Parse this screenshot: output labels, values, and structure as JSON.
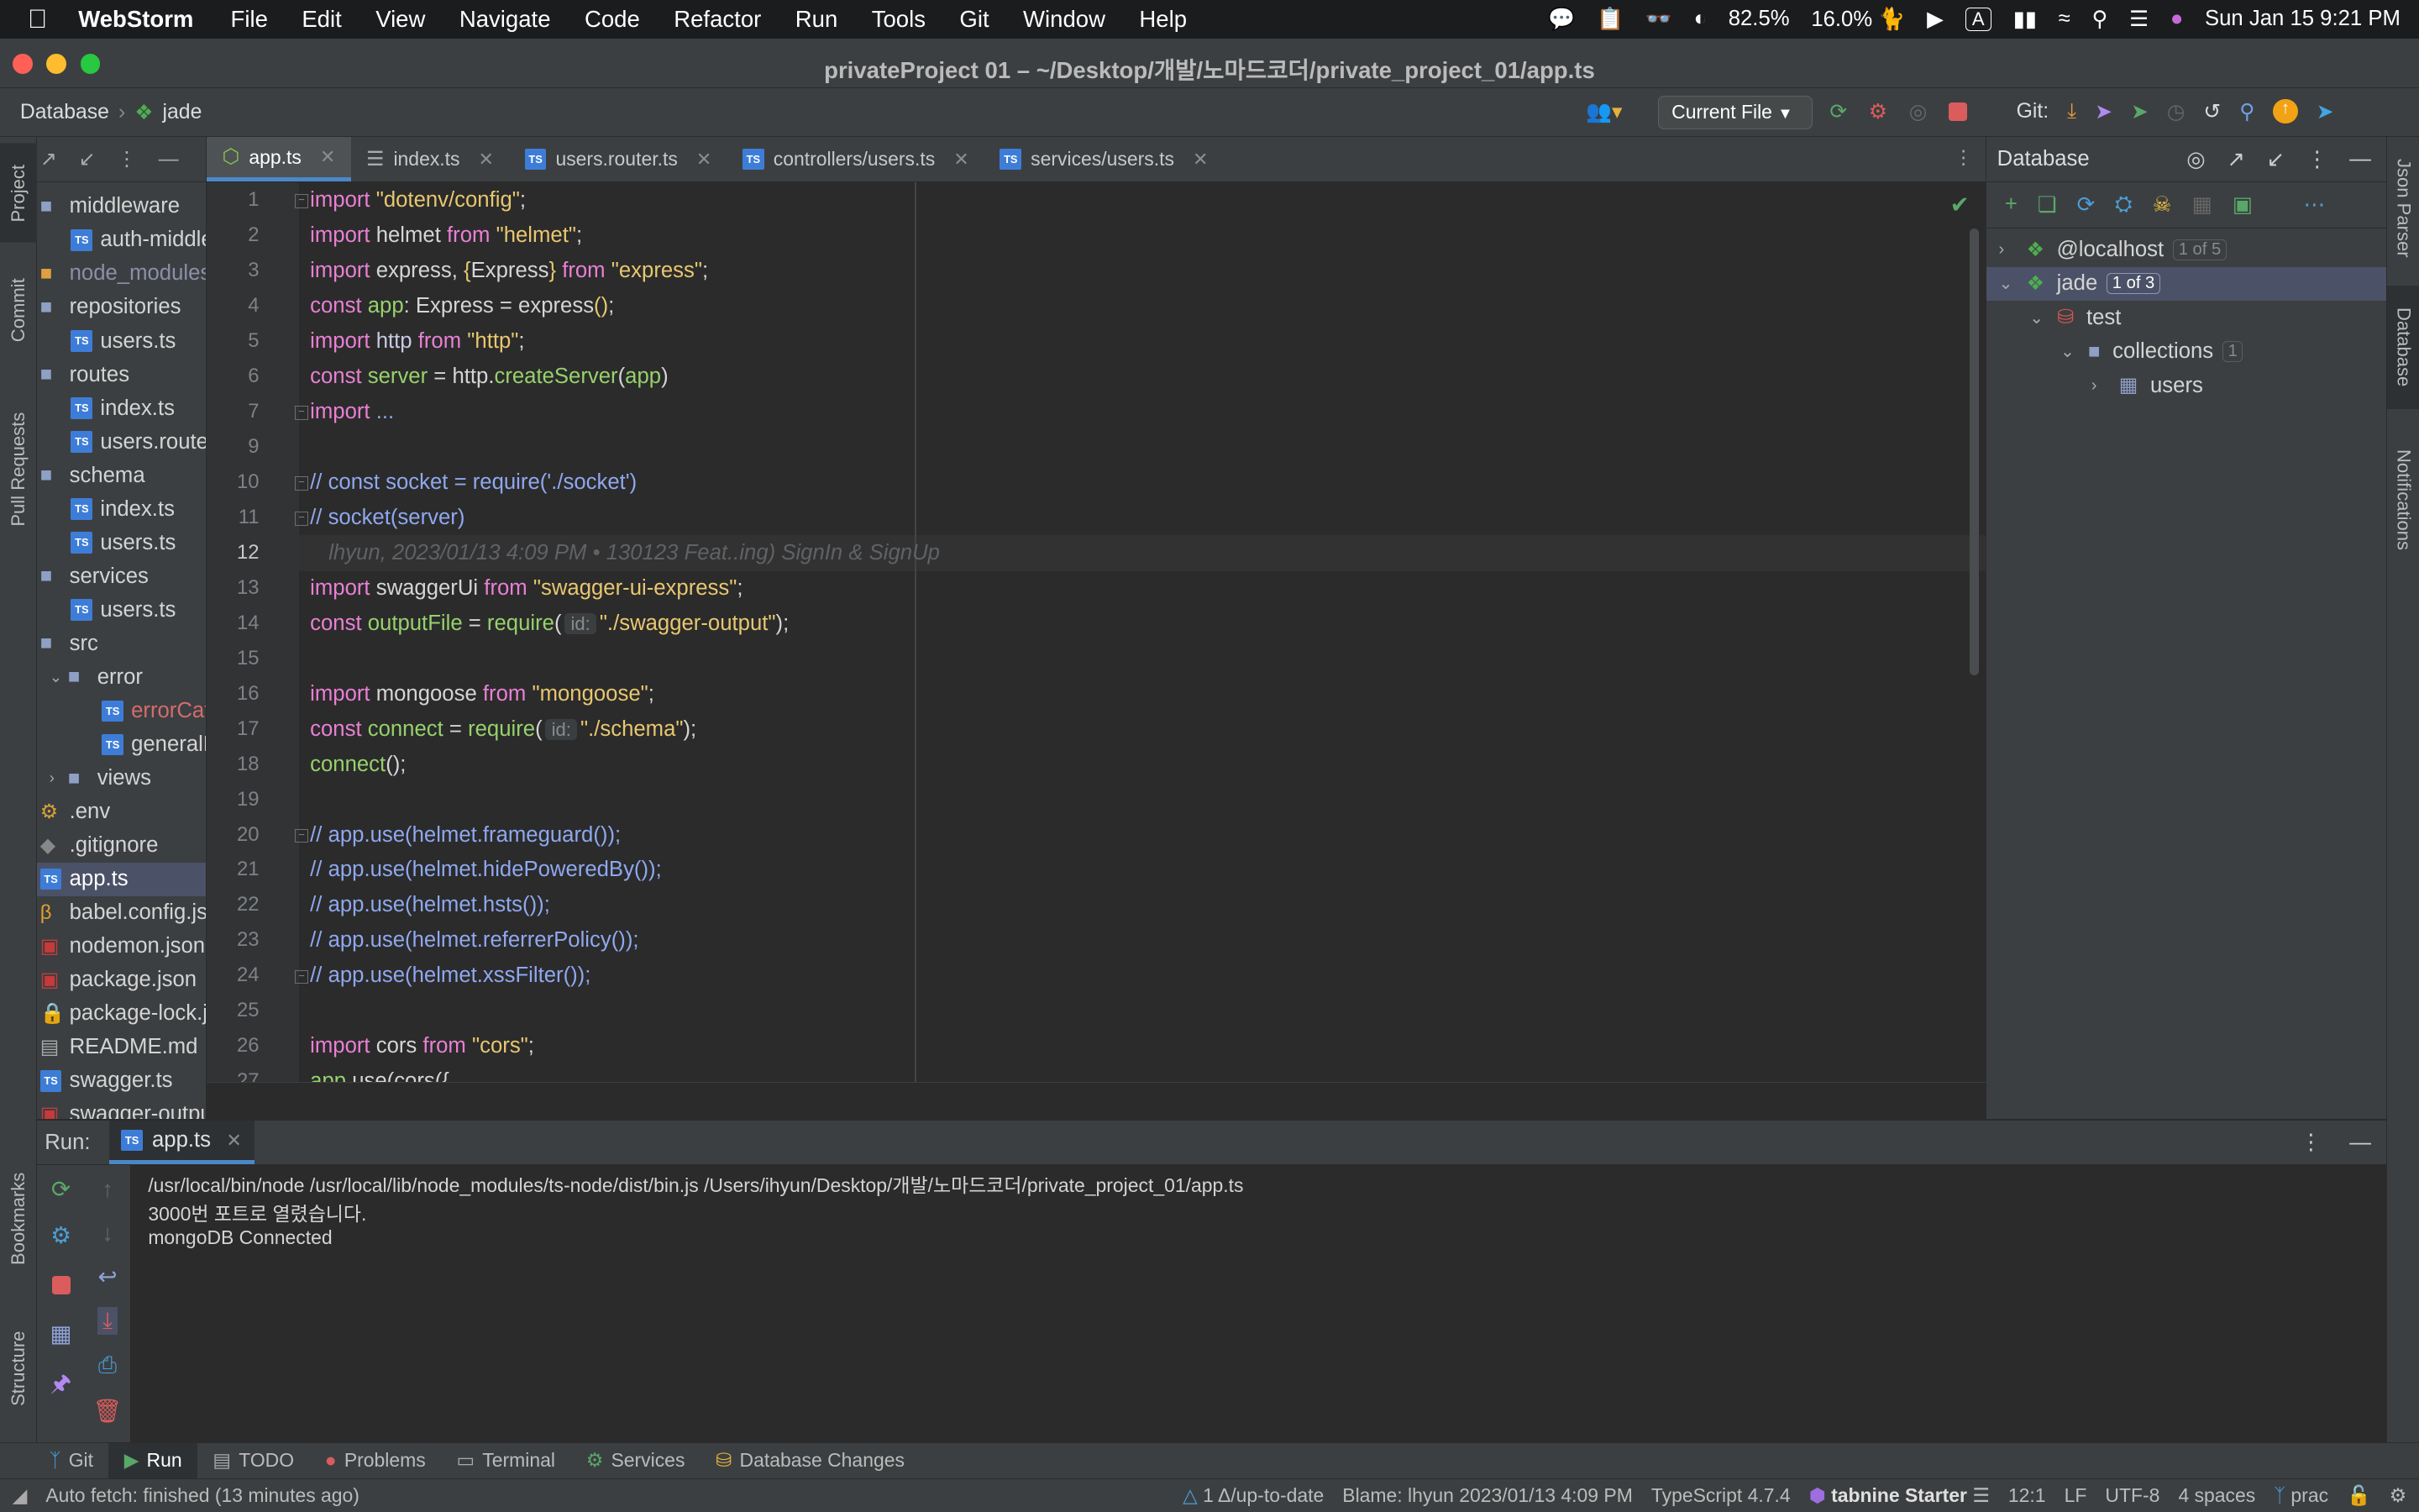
{
  "menubar": {
    "app": "WebStorm",
    "items": [
      "File",
      "Edit",
      "View",
      "Navigate",
      "Code",
      "Refactor",
      "Run",
      "Tools",
      "Git",
      "Window",
      "Help"
    ],
    "battery": "82.5%",
    "cpu": "16.0%",
    "input_source": "A",
    "datetime": "Sun Jan 15  9:21 PM"
  },
  "window": {
    "title": "privateProject 01 – ~/Desktop/개발/노마드코더/private_project_01/app.ts"
  },
  "navbar": {
    "crumbs": [
      "Database",
      "jade"
    ],
    "run_config": "Current File",
    "git_label": "Git:"
  },
  "left_strip": {
    "tabs": [
      "Project",
      "Commit",
      "Pull Requests",
      "Bookmarks",
      "Structure"
    ]
  },
  "project_tree": [
    {
      "label": "middleware",
      "indent": 0,
      "icon": "folder-icon",
      "color": "#d4d4d4"
    },
    {
      "label": "auth-middleware.ts",
      "indent": 1,
      "icon": "ts-file-icon",
      "color": "#d4d4d4"
    },
    {
      "label": "node_modules",
      "indent": 0,
      "icon": "folder-excluded-icon",
      "color": "#8d8fa8"
    },
    {
      "label": "repositories",
      "indent": 0,
      "icon": "folder-icon",
      "color": "#d4d4d4"
    },
    {
      "label": "users.ts",
      "indent": 1,
      "icon": "ts-file-icon",
      "color": "#d4d4d4"
    },
    {
      "label": "routes",
      "indent": 0,
      "icon": "folder-icon",
      "color": "#d4d4d4"
    },
    {
      "label": "index.ts",
      "indent": 1,
      "icon": "ts-file-icon",
      "color": "#d4d4d4"
    },
    {
      "label": "users.router.ts",
      "indent": 1,
      "icon": "ts-file-icon",
      "color": "#d4d4d4"
    },
    {
      "label": "schema",
      "indent": 0,
      "icon": "folder-icon",
      "color": "#d4d4d4"
    },
    {
      "label": "index.ts",
      "indent": 1,
      "icon": "ts-file-icon",
      "color": "#d4d4d4"
    },
    {
      "label": "users.ts",
      "indent": 1,
      "icon": "ts-file-icon",
      "color": "#d4d4d4"
    },
    {
      "label": "services",
      "indent": 0,
      "icon": "folder-icon",
      "color": "#d4d4d4"
    },
    {
      "label": "users.ts",
      "indent": 1,
      "icon": "ts-file-icon",
      "color": "#d4d4d4"
    },
    {
      "label": "src",
      "indent": 0,
      "icon": "folder-icon",
      "color": "#d4d4d4"
    },
    {
      "label": "error",
      "indent": 1,
      "icon": "folder-icon",
      "color": "#d4d4d4",
      "arrow": "down"
    },
    {
      "label": "errorCatcher.ts",
      "indent": 2,
      "icon": "ts-file-icon",
      "color": "#d46c6c"
    },
    {
      "label": "generalErrorHandler.ts",
      "indent": 2,
      "icon": "ts-file-icon",
      "color": "#d4d4d4"
    },
    {
      "label": "views",
      "indent": 1,
      "icon": "folder-icon",
      "color": "#d4d4d4",
      "arrow": "right"
    },
    {
      "label": ".env",
      "indent": 0,
      "icon": "env-file-icon",
      "color": "#d4d4d4"
    },
    {
      "label": ".gitignore",
      "indent": 0,
      "icon": "gitignore-icon",
      "color": "#d4d4d4"
    },
    {
      "label": "app.ts",
      "indent": 0,
      "icon": "ts-file-icon",
      "color": "#ffffff",
      "selected": true
    },
    {
      "label": "babel.config.js",
      "indent": 0,
      "icon": "babel-icon",
      "color": "#d4d4d4"
    },
    {
      "label": "nodemon.json",
      "indent": 0,
      "icon": "json-icon",
      "color": "#d4d4d4"
    },
    {
      "label": "package.json",
      "indent": 0,
      "icon": "npm-icon",
      "color": "#d4d4d4"
    },
    {
      "label": "package-lock.json",
      "indent": 0,
      "icon": "lock-icon",
      "color": "#d4d4d4"
    },
    {
      "label": "README.md",
      "indent": 0,
      "icon": "markdown-icon",
      "color": "#d4d4d4"
    },
    {
      "label": "swagger.ts",
      "indent": 0,
      "icon": "ts-file-icon",
      "color": "#d4d4d4"
    },
    {
      "label": "swagger-output.json",
      "indent": 0,
      "icon": "json-icon",
      "color": "#d4d4d4"
    }
  ],
  "tabs": [
    {
      "label": "app.ts",
      "icon": "node-icon",
      "active": true
    },
    {
      "label": "index.ts",
      "icon": "list-icon"
    },
    {
      "label": "users.router.ts",
      "icon": "ts-file-icon"
    },
    {
      "label": "controllers/users.ts",
      "icon": "ts-file-icon"
    },
    {
      "label": "services/users.ts",
      "icon": "ts-file-icon"
    }
  ],
  "editor": {
    "line_numbers": [
      "1",
      "2",
      "3",
      "4",
      "5",
      "6",
      "7",
      "9",
      "10",
      "11",
      "12",
      "13",
      "14",
      "15",
      "16",
      "17",
      "18",
      "19",
      "20",
      "21",
      "22",
      "23",
      "24",
      "25",
      "26",
      "27"
    ],
    "current_line": "12",
    "blame_hint": "lhyun, 2023/01/13 4:09 PM • 130123 Feat..ing) SignIn & SignUp",
    "param_hint": "id:",
    "lines": [
      [
        [
          "kw",
          "import "
        ],
        [
          "str",
          "\"dotenv/config\""
        ],
        [
          "p",
          ";"
        ]
      ],
      [
        [
          "kw",
          "import "
        ],
        [
          "p",
          "helmet "
        ],
        [
          "kw",
          "from "
        ],
        [
          "str",
          "\"helmet\""
        ],
        [
          "p",
          ";"
        ]
      ],
      [
        [
          "kw",
          "import "
        ],
        [
          "p",
          "express, "
        ],
        [
          "str",
          "{"
        ],
        [
          "p",
          "Express"
        ],
        [
          "str",
          "}"
        ],
        [
          "kw",
          " from "
        ],
        [
          "str",
          "\"express\""
        ],
        [
          "p",
          ";"
        ]
      ],
      [
        [
          "kw",
          "const "
        ],
        [
          "fn",
          "app"
        ],
        [
          "p",
          ": Express = express"
        ],
        [
          "str",
          "()"
        ],
        [
          "p",
          ";"
        ]
      ],
      [
        [
          "kw",
          "import "
        ],
        [
          "vr",
          "http "
        ],
        [
          "kw",
          "from "
        ],
        [
          "str",
          "\"http\""
        ],
        [
          "p",
          ";"
        ]
      ],
      [
        [
          "kw",
          "const "
        ],
        [
          "fn",
          "server"
        ],
        [
          "p",
          " = http."
        ],
        [
          "fn",
          "createServer"
        ],
        [
          "p",
          "("
        ],
        [
          "fn",
          "app"
        ],
        [
          "p",
          ")"
        ]
      ],
      [
        [
          "kw",
          "import "
        ],
        [
          "cm",
          "..."
        ]
      ],
      [],
      [
        [
          "cm",
          "// const socket = require('./socket')"
        ]
      ],
      [
        [
          "cm",
          "// socket(server)"
        ]
      ],
      [],
      [
        [
          "kw",
          "import "
        ],
        [
          "p",
          "swaggerUi "
        ],
        [
          "kw",
          "from "
        ],
        [
          "str",
          "\"swagger-ui-express\""
        ],
        [
          "p",
          ";"
        ]
      ],
      [
        [
          "kw",
          "const "
        ],
        [
          "fn",
          "outputFile"
        ],
        [
          "p",
          " = "
        ],
        [
          "fn",
          "require"
        ],
        [
          "p",
          "("
        ],
        [
          "hint",
          "id:"
        ],
        [
          "str",
          "\"./swagger-output\""
        ],
        [
          "p",
          ");"
        ]
      ],
      [],
      [
        [
          "kw",
          "import "
        ],
        [
          "p",
          "mongoose "
        ],
        [
          "kw",
          "from "
        ],
        [
          "str",
          "\"mongoose\""
        ],
        [
          "p",
          ";"
        ]
      ],
      [
        [
          "kw",
          "const "
        ],
        [
          "fn",
          "connect"
        ],
        [
          "p",
          " = "
        ],
        [
          "fn",
          "require"
        ],
        [
          "p",
          "("
        ],
        [
          "hint",
          "id:"
        ],
        [
          "str",
          "\"./schema\""
        ],
        [
          "p",
          ");"
        ]
      ],
      [
        [
          "fn",
          "connect"
        ],
        [
          "p",
          "();"
        ]
      ],
      [],
      [
        [
          "cm",
          "// app.use(helmet.frameguard());"
        ]
      ],
      [
        [
          "cm",
          "// app.use(helmet.hidePoweredBy());"
        ]
      ],
      [
        [
          "cm",
          "// app.use(helmet.hsts());"
        ]
      ],
      [
        [
          "cm",
          "// app.use(helmet.referrerPolicy());"
        ]
      ],
      [
        [
          "cm",
          "// app.use(helmet.xssFilter());"
        ]
      ],
      [],
      [
        [
          "kw",
          "import "
        ],
        [
          "p",
          "cors "
        ],
        [
          "kw",
          "from "
        ],
        [
          "str",
          "\"cors\""
        ],
        [
          "p",
          ";"
        ]
      ],
      [
        [
          "fn",
          "app"
        ],
        [
          "p",
          ".use(cors({"
        ]
      ]
    ]
  },
  "database": {
    "title": "Database",
    "rows": [
      {
        "label": "@localhost",
        "badge": "1 of 5",
        "indent": 0,
        "arrow": "right",
        "icon": "mongo-leaf-icon"
      },
      {
        "label": "jade",
        "badge": "1 of 3",
        "indent": 0,
        "arrow": "down",
        "icon": "mongo-leaf-icon",
        "selected": true
      },
      {
        "label": "test",
        "indent": 1,
        "arrow": "down",
        "icon": "database-icon"
      },
      {
        "label": "collections",
        "badge": "1",
        "indent": 2,
        "arrow": "down",
        "icon": "folder-icon"
      },
      {
        "label": "users",
        "indent": 3,
        "arrow": "right",
        "icon": "table-icon"
      }
    ]
  },
  "right_strip": {
    "tabs": [
      "Json Parser",
      "Database",
      "Notifications"
    ]
  },
  "run": {
    "label": "Run:",
    "tab": "app.ts",
    "output": [
      "/usr/local/bin/node /usr/local/lib/node_modules/ts-node/dist/bin.js /Users/ihyun/Desktop/개발/노마드코더/private_project_01/app.ts",
      "3000번 포트로 열렸습니다.",
      "mongoDB Connected"
    ]
  },
  "tool_windows": [
    {
      "label": "Git",
      "icon": "git-branch-icon"
    },
    {
      "label": "Run",
      "icon": "run-icon",
      "active": true
    },
    {
      "label": "TODO",
      "icon": "todo-icon"
    },
    {
      "label": "Problems",
      "icon": "problems-icon"
    },
    {
      "label": "Terminal",
      "icon": "terminal-icon"
    },
    {
      "label": "Services",
      "icon": "services-icon"
    },
    {
      "label": "Database Changes",
      "icon": "db-changes-icon"
    }
  ],
  "status": {
    "message": "Auto fetch: finished (13 minutes ago)",
    "vcs_status": "1 Δ/up-to-date",
    "blame": "Blame: lhyun 2023/01/13 4:09 PM",
    "language": "TypeScript 4.7.4",
    "tabnine": "tabnine Starter",
    "position": "12:1",
    "line_sep": "LF",
    "encoding": "UTF-8",
    "indent": "4 spaces",
    "branch": "prac"
  },
  "colors": {
    "accent": "#4a88c7",
    "selection": "#4b5267",
    "keyword": "#e980d4",
    "string": "#e8c770",
    "function": "#97d16d",
    "comment": "#8fa8ef"
  }
}
